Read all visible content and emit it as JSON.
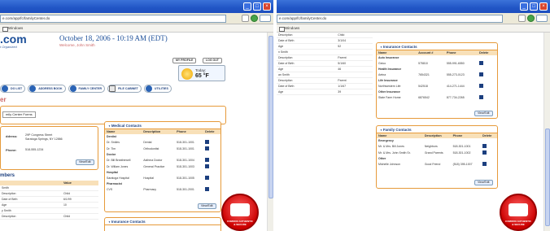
{
  "left": {
    "address": "e.com/app/fc/familyCenter.do",
    "tab_label": "Windows",
    "logo": ".com",
    "logo_sub": "t Organized",
    "datetime": "October 18, 2006 - 10:19 AM (EDT)",
    "welcome": "Welcome, John Smith",
    "my_profile": "MY PROFILE",
    "logout": "LOG OUT",
    "weather": {
      "label": "Today:",
      "temp": "65 °F"
    },
    "nav": [
      "DO LIST",
      "ADDRESS BOOK",
      "FAMILY CENTER",
      "FILE CABINET",
      "UTILITIES"
    ],
    "section_title": "er",
    "forms_button": "mily Center Forms",
    "address_label": "ddress:",
    "address_lines": [
      "29P Congress Street",
      "Saratoga Springs, NY 12866"
    ],
    "phone_label": "Phone:",
    "phone_value": "518-555-1234",
    "view_edit": "View/Edit",
    "members_title": "mbers",
    "members_headers": [
      "",
      "Value"
    ],
    "members_rows": [
      [
        "Smith",
        ""
      ],
      [
        "Description",
        "Child"
      ],
      [
        "Date of Birth",
        "6/1/99"
      ],
      [
        "Age",
        "10"
      ],
      [
        "y Smith",
        ""
      ],
      [
        "Description",
        "Child"
      ]
    ],
    "medical": {
      "title": "Medical Contacts",
      "headers": [
        "Name",
        "Description",
        "Phone",
        "Delete"
      ],
      "rows": [
        {
          "cat": "Dentist"
        },
        {
          "name": "Dr. Smiles",
          "desc": "Dental",
          "phone": "518-301-1001"
        },
        {
          "name": "Dr. Tim",
          "desc": "Orthodontist",
          "phone": "518-301-1001"
        },
        {
          "cat": "Doctor"
        },
        {
          "name": "Dr. Bill Breathewell",
          "desc": "Asthma Doctor",
          "phone": "518-301-1004"
        },
        {
          "name": "Dr. Willam Jones",
          "desc": "General Practice",
          "phone": "518-301-1003"
        },
        {
          "cat": "Hospital"
        },
        {
          "name": "Saratoga Hospital",
          "desc": "Hospital",
          "phone": "518-301-1005"
        },
        {
          "cat": "Pharmacist"
        },
        {
          "name": "CVS",
          "desc": "Pharmacy",
          "phone": "518-301-2001"
        }
      ]
    },
    "insurance_title": "Insurance Contacts"
  },
  "right": {
    "address": "e.com/app/fc/familyCenter.do",
    "tab_label": "Windows",
    "members_rows": [
      [
        "Description",
        "Child"
      ],
      [
        "Date of Birth",
        "3/1/04"
      ],
      [
        "Age",
        "52"
      ],
      [
        "n Smith",
        ""
      ],
      [
        "Description",
        "Parent"
      ],
      [
        "Date of Birth",
        "5/1/60"
      ],
      [
        "Age",
        "46"
      ],
      [
        "an Smith",
        ""
      ],
      [
        "Description",
        "Parent"
      ],
      [
        "Date of Birth",
        "1/1/67"
      ],
      [
        "Age",
        "39"
      ]
    ],
    "insurance": {
      "title": "Insurance Contacts",
      "headers": [
        "Name",
        "Account #",
        "Phone",
        "Delete"
      ],
      "rows": [
        {
          "cat": "Auto Insurance"
        },
        {
          "name": "Geico",
          "acct": "575810",
          "phone": "555-991-6550"
        },
        {
          "cat": "Health Insurance"
        },
        {
          "name": "Aetna",
          "acct": "7654321",
          "phone": "555-273-0123"
        },
        {
          "cat": "Life Insurance"
        },
        {
          "name": "Northwestern Life",
          "acct": "542518",
          "phone": "414-271-1444"
        },
        {
          "cat": "Other Insurance"
        },
        {
          "name": "State Farm Home",
          "acct": "6876542",
          "phone": "877-734-2265"
        }
      ]
    },
    "family": {
      "title": "Family Contacts",
      "headers": [
        "Name",
        "Description",
        "Phone",
        "Delete"
      ],
      "rows": [
        {
          "cat": "Emergency"
        },
        {
          "name": "Mr. & Mrs. Bill Jones",
          "desc": "Neighbors",
          "phone": "518-301-1001"
        },
        {
          "name": "Mr. & Mrs. John Smith Sr.",
          "desc": "Grand Parents",
          "phone": "518-301-1002"
        },
        {
          "cat": "Other"
        },
        {
          "name": "Michelle Johnson",
          "desc": "Good Friend",
          "phone": "(518) 395-1007"
        }
      ]
    },
    "view_edit": "View/Edit"
  },
  "badge_text": "COMODO AUTHENTIC & SECURE",
  "colors": {
    "title_bar": "#2155c5",
    "panel_border": "#e69a3a",
    "accent_blue": "#1c4f99",
    "table_header": "#f8e0b8"
  }
}
